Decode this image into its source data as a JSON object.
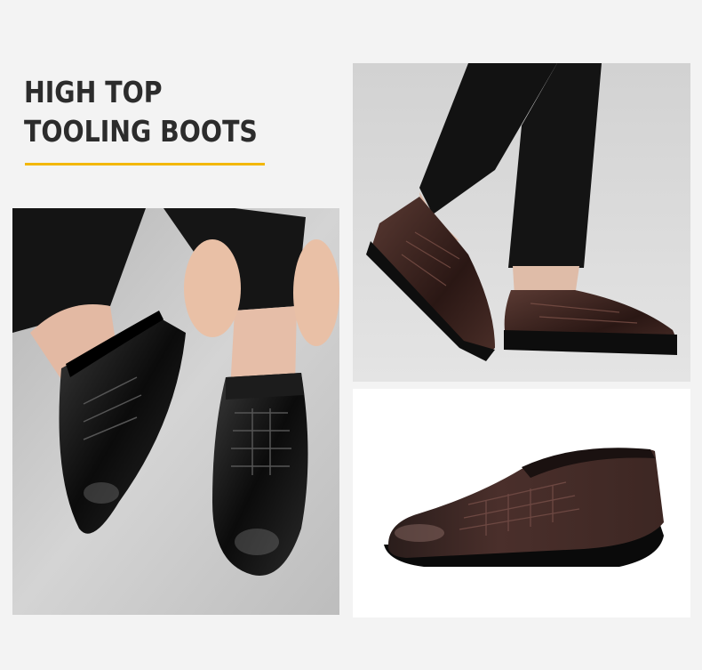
{
  "headline": {
    "line1": "HIGH TOP",
    "line2": "TOOLING BOOTS"
  },
  "colors": {
    "accent": "#f2b705",
    "text": "#2c2c2c",
    "background": "#f3f3f3"
  },
  "photos": [
    {
      "name": "hands-adjusting-black-loafers-photo"
    },
    {
      "name": "walking-brown-loafers-photo"
    },
    {
      "name": "brown-loafer-product-photo"
    }
  ]
}
